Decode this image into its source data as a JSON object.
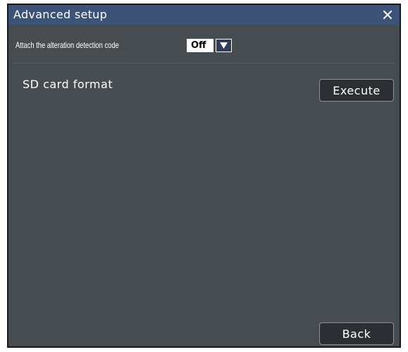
{
  "dialog": {
    "title": "Advanced setup",
    "close_icon": "close-icon"
  },
  "alteration": {
    "label": "Attach the alteration detection code",
    "value": "Off",
    "arrow_icon": "triangle-down-icon"
  },
  "sd_card": {
    "label": "SD card format",
    "execute_label": "Execute"
  },
  "footer": {
    "back_label": "Back"
  },
  "colors": {
    "dialog_background": "#474c51",
    "title_bar": "#3c5276",
    "button_background": "#2b2f33",
    "select_arrow_background": "#2f3d59"
  }
}
